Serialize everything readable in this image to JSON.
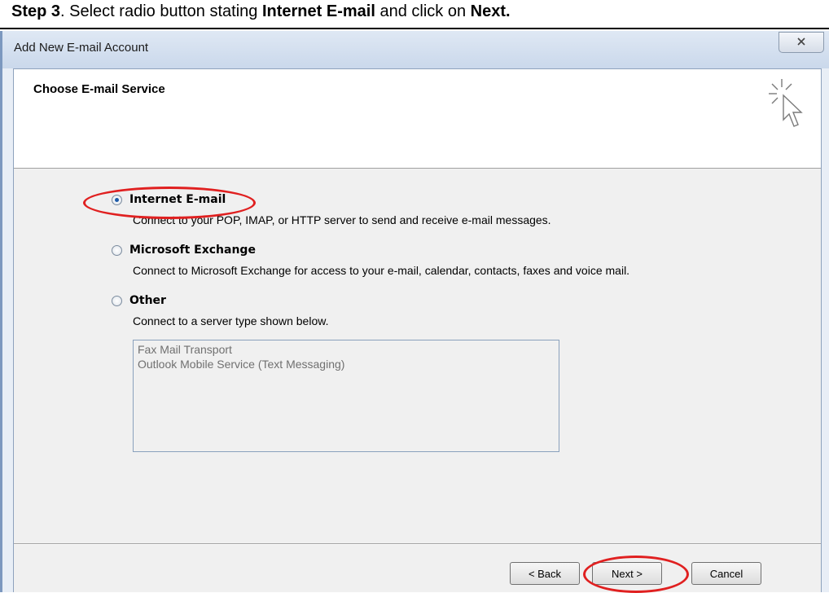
{
  "caption": {
    "step": "Step 3",
    "text1": ". Select radio button stating ",
    "bold1": "Internet E-mail",
    "text2": " and click on ",
    "bold2": "Next."
  },
  "window": {
    "title": "Add New E-mail Account",
    "close_icon": "close-icon",
    "header_title": "Choose E-mail Service",
    "header_icon": "wizard-cursor-icon"
  },
  "options": [
    {
      "label": "Internet E-mail",
      "description": "Connect to your POP, IMAP, or HTTP server to send and receive e-mail messages.",
      "selected": true
    },
    {
      "label": "Microsoft Exchange",
      "description": "Connect to Microsoft Exchange for access to your e-mail, calendar, contacts, faxes and voice mail.",
      "selected": false
    },
    {
      "label": "Other",
      "description": "Connect to a server type shown below.",
      "selected": false
    }
  ],
  "server_types": [
    "Fax Mail Transport",
    "Outlook Mobile Service (Text Messaging)"
  ],
  "buttons": {
    "back": "< Back",
    "next": "Next >",
    "cancel": "Cancel"
  },
  "colors": {
    "highlight": "#e02020",
    "accent": "#1c5aa8"
  }
}
